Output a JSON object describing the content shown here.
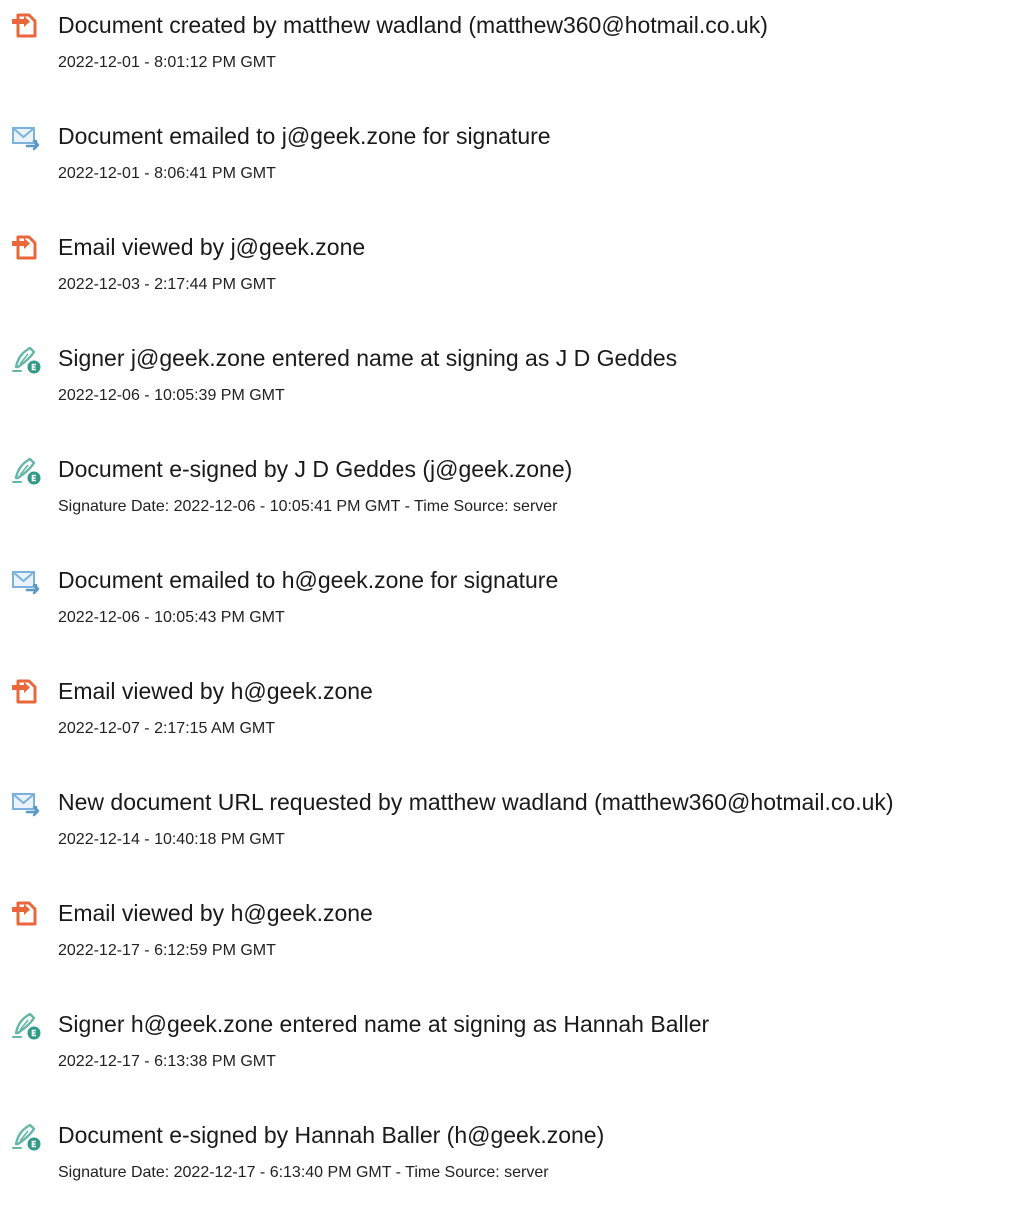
{
  "colors": {
    "doc_icon": "#e8673b",
    "email_icon": "#7cb2dc",
    "email_arrow": "#5a98c9",
    "sign_icon": "#64b7a6",
    "sign_badge": "#2f9a88"
  },
  "events": [
    {
      "icon": "document-icon",
      "title": "Document created by matthew wadland (matthew360@hotmail.co.uk)",
      "meta": "2022-12-01 - 8:01:12 PM GMT"
    },
    {
      "icon": "email-icon",
      "title": "Document emailed to j@geek.zone for signature",
      "meta": "2022-12-01 - 8:06:41 PM GMT"
    },
    {
      "icon": "document-icon",
      "title": "Email viewed by j@geek.zone",
      "meta": "2022-12-03 - 2:17:44 PM GMT"
    },
    {
      "icon": "signature-icon",
      "title": "Signer j@geek.zone entered name at signing as J D Geddes",
      "meta": "2022-12-06 - 10:05:39 PM GMT"
    },
    {
      "icon": "signature-icon",
      "title": "Document e-signed by J D Geddes (j@geek.zone)",
      "meta": "Signature Date: 2022-12-06 - 10:05:41 PM GMT - Time Source: server"
    },
    {
      "icon": "email-icon",
      "title": "Document emailed to h@geek.zone for signature",
      "meta": "2022-12-06 - 10:05:43 PM GMT"
    },
    {
      "icon": "document-icon",
      "title": "Email viewed by h@geek.zone",
      "meta": "2022-12-07 - 2:17:15 AM GMT"
    },
    {
      "icon": "email-icon",
      "title": "New document URL requested by matthew wadland (matthew360@hotmail.co.uk)",
      "meta": "2022-12-14 - 10:40:18 PM GMT"
    },
    {
      "icon": "document-icon",
      "title": "Email viewed by h@geek.zone",
      "meta": "2022-12-17 - 6:12:59 PM GMT"
    },
    {
      "icon": "signature-icon",
      "title": "Signer h@geek.zone entered name at signing as Hannah Baller",
      "meta": "2022-12-17 - 6:13:38 PM GMT"
    },
    {
      "icon": "signature-icon",
      "title": "Document e-signed by Hannah Baller (h@geek.zone)",
      "meta": "Signature Date: 2022-12-17 - 6:13:40 PM GMT - Time Source: server"
    }
  ]
}
